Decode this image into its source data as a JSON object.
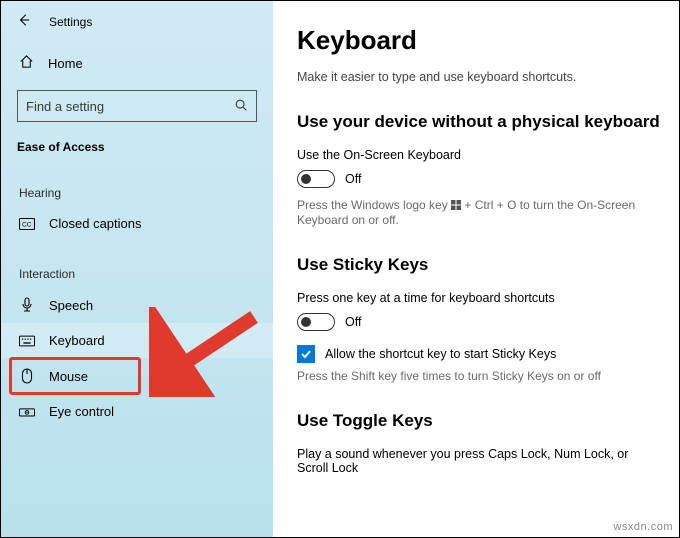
{
  "header": {
    "title": "Settings"
  },
  "sidebar": {
    "home_label": "Home",
    "search_placeholder": "Find a setting",
    "group_header": "Ease of Access",
    "subgroup_hearing": "Hearing",
    "subgroup_interaction": "Interaction",
    "items": {
      "closed_captions": "Closed captions",
      "speech": "Speech",
      "keyboard": "Keyboard",
      "mouse": "Mouse",
      "eye_control": "Eye control"
    }
  },
  "content": {
    "title": "Keyboard",
    "subtitle": "Make it easier to type and use keyboard shortcuts.",
    "section1": {
      "heading": "Use your device without a physical keyboard",
      "label": "Use the On-Screen Keyboard",
      "toggle_state": "Off",
      "hint_pre": "Press the Windows logo key ",
      "hint_post": " + Ctrl + O to turn the On-Screen Keyboard on or off."
    },
    "section2": {
      "heading": "Use Sticky Keys",
      "label": "Press one key at a time for keyboard shortcuts",
      "toggle_state": "Off",
      "checkbox_label": "Allow the shortcut key to start Sticky Keys",
      "hint": "Press the Shift key five times to turn Sticky Keys on or off"
    },
    "section3": {
      "heading": "Use Toggle Keys",
      "label": "Play a sound whenever you press Caps Lock, Num Lock, or Scroll Lock"
    }
  },
  "watermark": "wsxdn.com"
}
